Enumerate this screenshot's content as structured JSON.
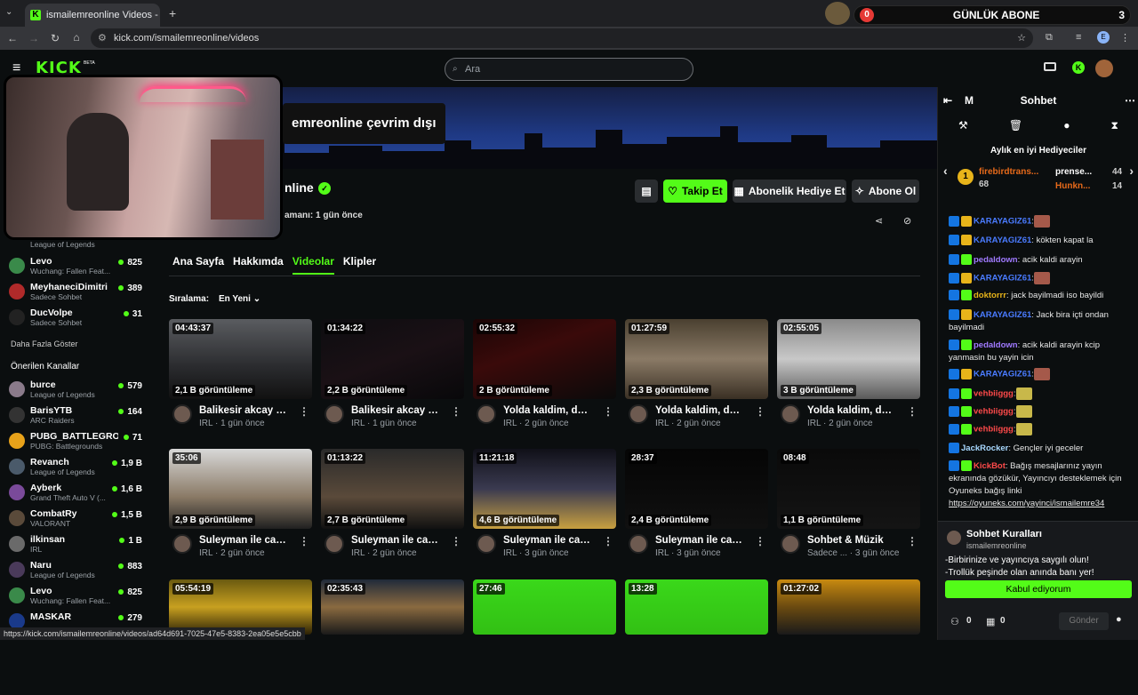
{
  "browser": {
    "tab_title": "ismailemreonline Videos - Watc",
    "url": "kick.com/ismailemreonline/videos",
    "status_url": "https://kick.com/ismailemreonline/videos/ad64d691-7025-47e5-8383-2ea05e5e5cbb",
    "widget": {
      "left": "0",
      "label": "GÜNLÜK ABONE",
      "right": "3"
    }
  },
  "header": {
    "logo": "KICK",
    "logo_badge": "BETA",
    "search_placeholder": "Ara"
  },
  "sidebar": {
    "following": [
      {
        "name": "",
        "category": "League of Legends",
        "count": ""
      },
      {
        "name": "Levo",
        "category": "Wuchang: Fallen Feat...",
        "count": "825"
      },
      {
        "name": "MeyhaneciDimitri",
        "category": "Sadece Sohbet",
        "count": "389"
      },
      {
        "name": "DucVolpe",
        "category": "Sadece Sohbet",
        "count": "31"
      }
    ],
    "show_more": "Daha Fazla Göster",
    "recommended_title": "Önerilen Kanallar",
    "recommended": [
      {
        "name": "burce",
        "category": "League of Legends",
        "count": "579"
      },
      {
        "name": "BarisYTB",
        "category": "ARC Raiders",
        "count": "164"
      },
      {
        "name": "PUBG_BATTLEGRO...",
        "category": "PUBG: Battlegrounds",
        "count": "71"
      },
      {
        "name": "Revanch",
        "category": "League of Legends",
        "count": "1,9 B"
      },
      {
        "name": "Ayberk",
        "category": "Grand Theft Auto V (...",
        "count": "1,6 B"
      },
      {
        "name": "CombatRy",
        "category": "VALORANT",
        "count": "1,5 B"
      },
      {
        "name": "ilkinsan",
        "category": "IRL",
        "count": "1 B"
      },
      {
        "name": "Naru",
        "category": "League of Legends",
        "count": "883"
      },
      {
        "name": "Levo",
        "category": "Wuchang: Fallen Feat...",
        "count": "825"
      },
      {
        "name": "MASKAR",
        "category": "",
        "count": "279"
      }
    ]
  },
  "channel": {
    "offline_text": "emreonline çevrim dışı",
    "name": "nline",
    "last_live": "amanı: 1 gün önce",
    "follow": "Takip Et",
    "gift_sub": "Abonelik Hediye Et",
    "subscribe": "Abone Ol"
  },
  "tabs": [
    "Ana Sayfa",
    "Hakkımda",
    "Videolar",
    "Klipler"
  ],
  "sort": {
    "label": "Sıralama:",
    "value": "En Yeni"
  },
  "videos": [
    {
      "duration": "04:43:37",
      "views": "2,1 B görüntüleme",
      "title": "Balikesir akcay d...",
      "category": "IRL",
      "ago": "1 gün önce"
    },
    {
      "duration": "01:34:22",
      "views": "2,2 B görüntüleme",
      "title": "Balikesir akcay d...",
      "category": "IRL",
      "ago": "1 gün önce"
    },
    {
      "duration": "02:55:32",
      "views": "2 B görüntüleme",
      "title": "Yolda kaldim, dol...",
      "category": "IRL",
      "ago": "2 gün önce"
    },
    {
      "duration": "01:27:59",
      "views": "2,3 B görüntüleme",
      "title": "Yolda kaldim, dol...",
      "category": "IRL",
      "ago": "2 gün önce"
    },
    {
      "duration": "02:55:05",
      "views": "3 B görüntüleme",
      "title": "Yolda kaldim, dol...",
      "category": "IRL",
      "ago": "2 gün önce"
    },
    {
      "duration": "35:06",
      "views": "2,9 B görüntüleme",
      "title": "Suleyman ile can...",
      "category": "IRL",
      "ago": "2 gün önce"
    },
    {
      "duration": "01:13:22",
      "views": "2,7 B görüntüleme",
      "title": "Suleyman ile can...",
      "category": "IRL",
      "ago": "2 gün önce"
    },
    {
      "duration": "11:21:18",
      "views": "4,6 B görüntüleme",
      "title": "Suleyman ile can...",
      "category": "IRL",
      "ago": "3 gün önce"
    },
    {
      "duration": "28:37",
      "views": "2,4 B görüntüleme",
      "title": "Suleyman ile can...",
      "category": "IRL",
      "ago": "3 gün önce"
    },
    {
      "duration": "08:48",
      "views": "1,1 B görüntüleme",
      "title": "Sohbet & Müzik",
      "category": "Sadece ...",
      "ago": "3 gün önce"
    },
    {
      "duration": "05:54:19",
      "views": "",
      "title": "",
      "category": "",
      "ago": ""
    },
    {
      "duration": "02:35:43",
      "views": "",
      "title": "",
      "category": "",
      "ago": ""
    },
    {
      "duration": "27:46",
      "views": "",
      "title": "",
      "category": "",
      "ago": ""
    },
    {
      "duration": "13:28",
      "views": "",
      "title": "",
      "category": "",
      "ago": ""
    },
    {
      "duration": "01:27:02",
      "views": "",
      "title": "",
      "category": "",
      "ago": ""
    }
  ],
  "chat": {
    "header": "Sohbet",
    "header_left": "M",
    "top_gifters_title": "Aylık en iyi Hediyeciler",
    "gifters": [
      {
        "rank": "1",
        "name": "firebirdtrans...",
        "count": "68"
      },
      {
        "name": "prense...",
        "count": "44"
      },
      {
        "name": "Hunkn...",
        "count": "14"
      }
    ],
    "messages": [
      {
        "user": "KARAYAGIZ61",
        "text": ":"
      },
      {
        "user": "KARAYAGIZ61",
        "text": ": kökten kapat la"
      },
      {
        "user": "pedaldown",
        "text": ": acik kaldi arayin"
      },
      {
        "user": "KARAYAGIZ61",
        "text": ":"
      },
      {
        "user": "doktorrr",
        "text": ": jack bayilmadi iso bayildi"
      },
      {
        "user": "KARAYAGIZ61",
        "text": ": Jack bira içti ondan bayilmadi"
      },
      {
        "user": "pedaldown",
        "text": ": acik kaldi arayin kcip yanmasin bu yayin icin"
      },
      {
        "user": "KARAYAGIZ61",
        "text": ":"
      },
      {
        "user": "vehbiiggg",
        "text": ":"
      },
      {
        "user": "vehbiiggg",
        "text": ":"
      },
      {
        "user": "vehbiiggg",
        "text": ":"
      },
      {
        "user": "JackRocker",
        "text": ": Gençler iyi geceler"
      },
      {
        "user": "KickBot",
        "text": ": Bağış mesajlarınız yayın ekranında gözükür, Yayıncıyı desteklemek için Oyuneks bağış linki"
      },
      {
        "user": "",
        "text": "https://oyuneks.com/yayinci/ismailemre34"
      }
    ],
    "rules": {
      "title": "Sohbet Kuralları",
      "channel": "ismailemreonline",
      "line1": "-Birbirinize ve yayıncıya saygılı olun!",
      "line2": "-Trollük peşinde olan anında banı yer!",
      "accept": "Kabul ediyorum"
    },
    "footer": {
      "a": "0",
      "b": "0",
      "send": "Gönder"
    }
  },
  "colors": {
    "accent": "#53fc18",
    "bg": "#0b0e0f",
    "mod": "#1475e1"
  }
}
